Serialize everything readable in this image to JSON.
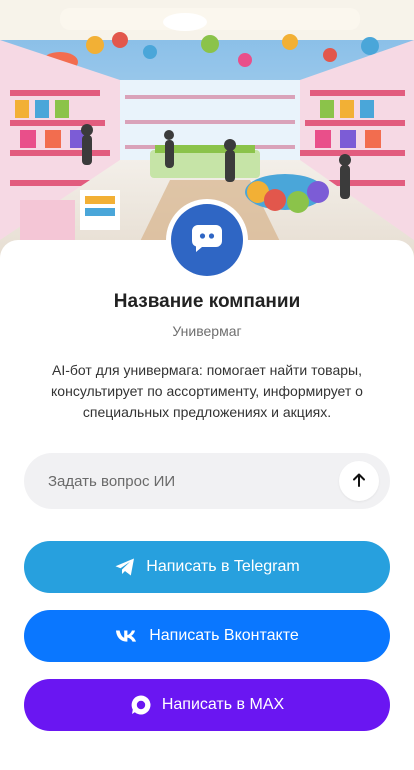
{
  "colors": {
    "avatar": "#2f66c4",
    "telegram": "#27a0de",
    "vkontakte": "#0a77ff",
    "max": "#6a16f2",
    "ask_background": "#f1f1f3"
  },
  "hero": {
    "image_alt": "toy store interior",
    "icon": "store-photo"
  },
  "profile": {
    "avatar_icon": "chat-bot-icon",
    "name": "Название компании",
    "category": "Универмаг",
    "description": "AI-бот для универмага: помогает найти товары, консультирует по ассортименту, информирует о специальных предложениях и акциях."
  },
  "ask": {
    "placeholder": "Задать вопрос ИИ",
    "send_icon": "arrow-up-icon"
  },
  "buttons": [
    {
      "id": "telegram",
      "label": "Написать в Telegram",
      "icon": "telegram-icon"
    },
    {
      "id": "vkontakte",
      "label": "Написать Вконтакте",
      "icon": "vk-icon"
    },
    {
      "id": "max",
      "label": "Написать в MAX",
      "icon": "max-icon"
    }
  ]
}
